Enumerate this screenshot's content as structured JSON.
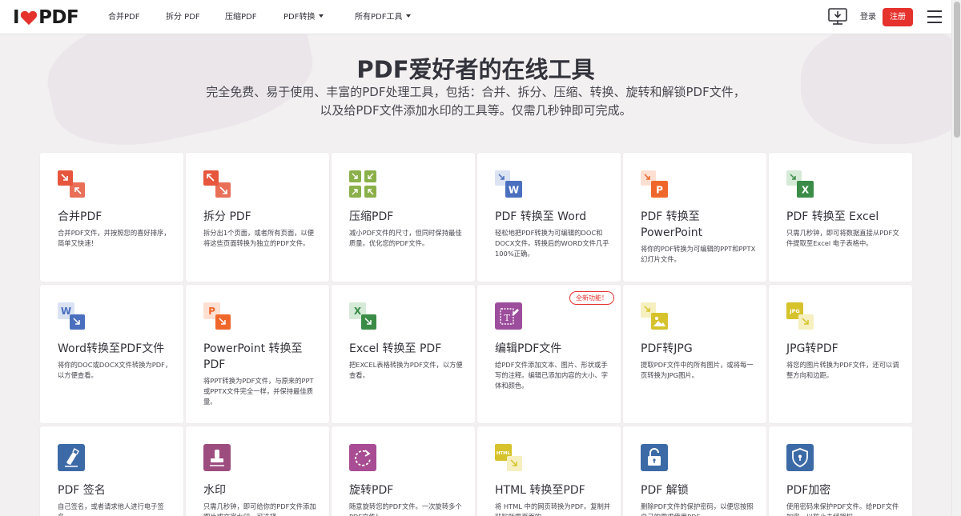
{
  "header": {
    "logo_left": "I",
    "logo_right": "PDF",
    "nav": [
      {
        "label": "合并PDF"
      },
      {
        "label": "拆分 PDF"
      },
      {
        "label": "压缩PDF"
      },
      {
        "label": "PDF转换"
      },
      {
        "label": "所有PDF工具"
      }
    ],
    "login": "登录",
    "signup": "注册"
  },
  "hero": {
    "title": "PDF爱好者的在线工具",
    "subtitle": "完全免费、易于使用、丰富的PDF处理工具，包括：合并、拆分、压缩、转换、旋转和解锁PDF文件，以及给PDF文件添加水印的工具等。仅需几秒钟即可完成。"
  },
  "tools": [
    {
      "title": "合并PDF",
      "desc": "合并PDF文件，并按照您的喜好排序，简单又快速！",
      "icon": "merge-icon"
    },
    {
      "title": "拆分 PDF",
      "desc": "拆分出1个页面，或者所有页面，以便将这些页面转换为独立的PDF文件。",
      "icon": "split-icon"
    },
    {
      "title": "压缩PDF",
      "desc": "减小PDF文件的尺寸，但同时保持最佳质量。优化您的PDF文件。",
      "icon": "compress-icon"
    },
    {
      "title": "PDF 转换至 Word",
      "desc": "轻松地把PDF转换为可编辑的DOC和DOCX文件。转换后的WORD文件几乎100%正确。",
      "icon": "pdf-to-word-icon"
    },
    {
      "title": "PDF 转换至 PowerPoint",
      "desc": "将你的PDF转换为可编辑的PPT和PPTX幻灯片文件。",
      "icon": "pdf-to-ppt-icon"
    },
    {
      "title": "PDF 转换至 Excel",
      "desc": "只需几秒钟，即可将数据直接从PDF文件提取至Excel 电子表格中。",
      "icon": "pdf-to-excel-icon"
    },
    {
      "title": "Word转换至PDF文件",
      "desc": "将你的DOC或DOCX文件转换为PDF，以方便查看。",
      "icon": "word-to-pdf-icon"
    },
    {
      "title": "PowerPoint 转换至 PDF",
      "desc": "将PPT转换为PDF文件，与原来的PPT或PPTX文件完全一样，并保持最佳质量。",
      "icon": "ppt-to-pdf-icon"
    },
    {
      "title": "Excel 转换至 PDF",
      "desc": "把EXCEL表格转换为PDF文件，以方便查看。",
      "icon": "excel-to-pdf-icon"
    },
    {
      "title": "编辑PDF文件",
      "desc": "给PDF文件添加文本、图片、形状或手写的注释。编辑已添加内容的大小、字体和颜色。",
      "icon": "edit-pdf-icon",
      "badge": "全新功能！"
    },
    {
      "title": "PDF转JPG",
      "desc": "提取PDF文件中的所有图片，或将每一页转换为JPG图片。",
      "icon": "pdf-to-jpg-icon"
    },
    {
      "title": "JPG转PDF",
      "desc": "将您的图片转换为PDF文件，还可以调整方向和边距。",
      "icon": "jpg-to-pdf-icon"
    },
    {
      "title": "PDF 签名",
      "desc": "自己签名，或者请求他人进行电子签名。",
      "icon": "sign-pdf-icon"
    },
    {
      "title": "水印",
      "desc": "只需几秒钟，即可给你的PDF文件添加图片或文字水印。可选择",
      "icon": "watermark-icon"
    },
    {
      "title": "旋转PDF",
      "desc": "随意旋转您的PDF文件。一次旋转多个PDF文件！",
      "icon": "rotate-icon"
    },
    {
      "title": "HTML 转换至PDF",
      "desc": "将 HTML 中的网页转换为PDF。复制并粘贴所需页面的",
      "icon": "html-to-pdf-icon",
      "icon_text": "HTML"
    },
    {
      "title": "PDF 解锁",
      "desc": "删除PDF文件的保护密码，以便您按照自己的需求使用PDF",
      "icon": "unlock-icon"
    },
    {
      "title": "PDF加密",
      "desc": "使用密码来保护PDF文件。给PDF文件加密，以防止未经授权",
      "icon": "protect-icon"
    }
  ],
  "colors": {
    "brand_red": "#e5322d",
    "merge": "#e5563c",
    "compress": "#8bb04a",
    "word": "#4a6fbe",
    "ppt": "#f0672c",
    "excel": "#3a8c47",
    "edit": "#9c4d9c",
    "jpg": "#d6c32c",
    "sign": "#3c6aa6",
    "watermark": "#9c4d7e",
    "rotate": "#a84c93"
  }
}
